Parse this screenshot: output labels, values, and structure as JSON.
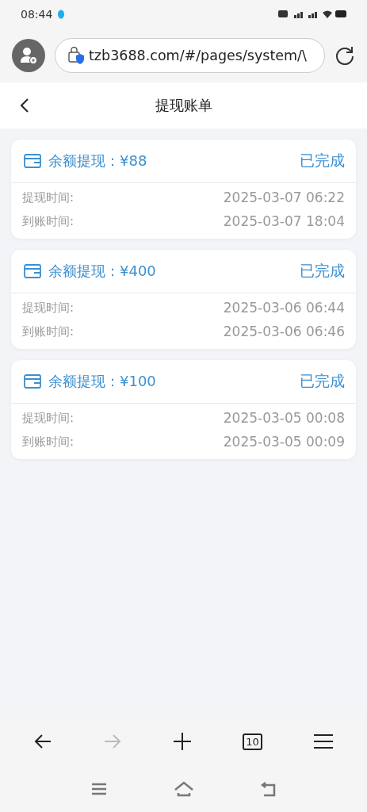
{
  "status_bar": {
    "time": "08:44"
  },
  "browser": {
    "url": "tzb3688.com/#/pages/system/\\",
    "tab_count": "10",
    "forward_disabled": true
  },
  "header": {
    "title": "提现账单"
  },
  "records": [
    {
      "title": "余额提现：¥88",
      "status": "已完成",
      "rows": [
        {
          "label": "提现时间:",
          "value": "2025-03-07 06:22"
        },
        {
          "label": "到账时间:",
          "value": "2025-03-07 18:04"
        }
      ]
    },
    {
      "title": "余额提现：¥400",
      "status": "已完成",
      "rows": [
        {
          "label": "提现时间:",
          "value": "2025-03-06 06:44"
        },
        {
          "label": "到账时间:",
          "value": "2025-03-06 06:46"
        }
      ]
    },
    {
      "title": "余额提现：¥100",
      "status": "已完成",
      "rows": [
        {
          "label": "提现时间:",
          "value": "2025-03-05 00:08"
        },
        {
          "label": "到账时间:",
          "value": "2025-03-05 00:09"
        }
      ]
    }
  ]
}
